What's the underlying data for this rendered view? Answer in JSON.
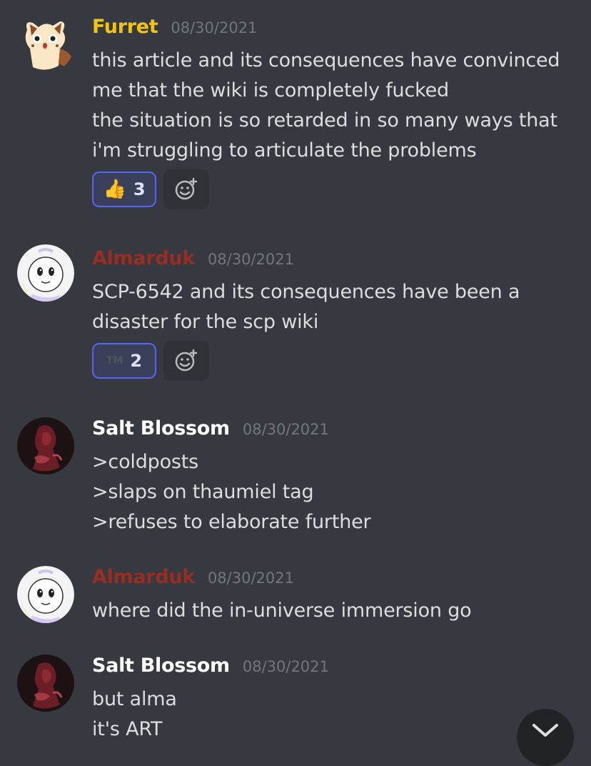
{
  "colors": {
    "background": "#36393f",
    "furret_name": "#f1c40f",
    "almarduk_name": "#992d22",
    "salt_name": "#ffffff",
    "timestamp": "#72767d",
    "reaction_border": "#5865f2"
  },
  "messages": [
    {
      "author": "Furret",
      "timestamp": "08/30/2021",
      "avatar": "furret-avatar",
      "lines": [
        "this article and its consequences have convinced",
        "me that the wiki is completely fucked",
        "the situation is so retarded in so many ways that",
        "i'm struggling to articulate the problems"
      ],
      "reaction": {
        "emoji": "👍",
        "icon": "thumbs-up-icon",
        "count": "3"
      }
    },
    {
      "author": "Almarduk",
      "timestamp": "08/30/2021",
      "avatar": "almarduk-avatar",
      "lines": [
        "SCP-6542 and its consequences have been a",
        "disaster for the scp wiki"
      ],
      "reaction": {
        "emoji": "TM",
        "icon": "tm-emoji-icon",
        "count": "2"
      }
    },
    {
      "author": "Salt Blossom",
      "timestamp": "08/30/2021",
      "avatar": "salt-blossom-avatar",
      "lines": [
        ">coldposts",
        ">slaps on thaumiel tag",
        ">refuses to elaborate further"
      ]
    },
    {
      "author": "Almarduk",
      "timestamp": "08/30/2021",
      "avatar": "almarduk-avatar",
      "lines": [
        "where did the in-universe immersion go"
      ]
    },
    {
      "author": "Salt Blossom",
      "timestamp": "08/30/2021",
      "avatar": "salt-blossom-avatar",
      "lines": [
        "but alma",
        "it's ART"
      ]
    }
  ]
}
